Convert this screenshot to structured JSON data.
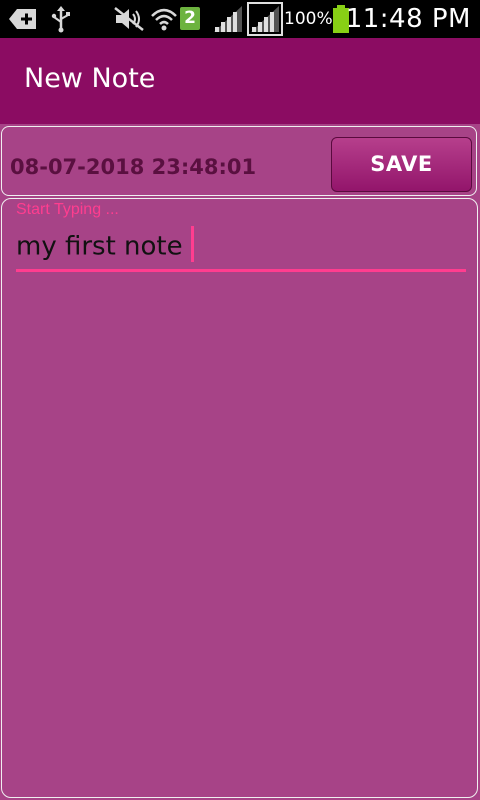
{
  "status_bar": {
    "sim_number": "2",
    "battery_percent": "100%",
    "time": "11:48 PM",
    "icons": [
      "add-notification-icon",
      "usb-icon",
      "mute-icon",
      "wifi-icon",
      "signal-icon",
      "signal-icon-2",
      "battery-icon"
    ]
  },
  "action_bar": {
    "title": "New Note"
  },
  "note": {
    "date": "08-07-2018 23:48:01",
    "save_label": "SAVE",
    "hint": "Start Typing ...",
    "text": "my first note"
  },
  "colors": {
    "action_bar": "#8b0c62",
    "background": "#a74387",
    "accent": "#ff3d8f"
  }
}
